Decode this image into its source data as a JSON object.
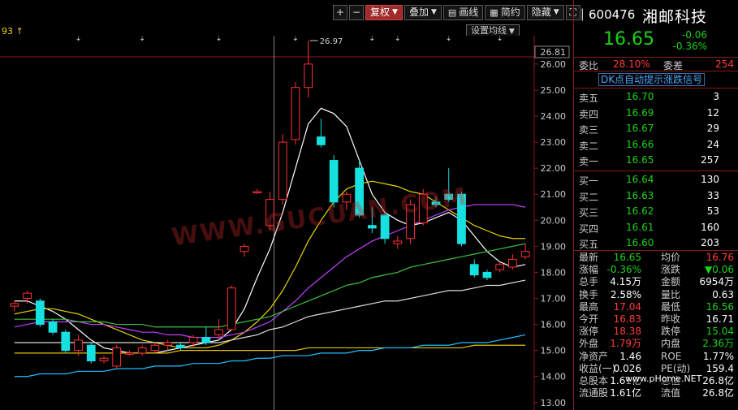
{
  "toolbar": {
    "plus": "+",
    "minus": "−",
    "fuquan": "复权",
    "diejia": "叠加",
    "huaxian": "画线",
    "jianyue": "简约",
    "yincang": "隐藏",
    "fullscreen": "⛶"
  },
  "ma_settings_label": "设置均线",
  "top_left_text": "93 ↑",
  "watermark": "WWW.GUCUAN.COM",
  "watermark2": "www.pHome.NET",
  "quote": {
    "code": "600476",
    "name": "湘邮科技",
    "price": "16.65",
    "change": "-0.06",
    "change_pct": "-0.36%"
  },
  "weibi": {
    "label": "委比",
    "value": "28.10%",
    "label2": "委差",
    "value2": "254"
  },
  "dk_signal": "DK点自动提示涨跌信号",
  "sell": [
    {
      "label": "卖五",
      "price": "16.70",
      "vol": "3"
    },
    {
      "label": "卖四",
      "price": "16.69",
      "vol": "12"
    },
    {
      "label": "卖三",
      "price": "16.67",
      "vol": "29"
    },
    {
      "label": "卖二",
      "price": "16.66",
      "vol": "24"
    },
    {
      "label": "卖一",
      "price": "16.65",
      "vol": "257"
    }
  ],
  "buy": [
    {
      "label": "买一",
      "price": "16.64",
      "vol": "130"
    },
    {
      "label": "买二",
      "price": "16.63",
      "vol": "33"
    },
    {
      "label": "买三",
      "price": "16.62",
      "vol": "53"
    },
    {
      "label": "买四",
      "price": "16.61",
      "vol": "160"
    },
    {
      "label": "买五",
      "price": "16.60",
      "vol": "203"
    }
  ],
  "stats": [
    {
      "l1": "最新",
      "v1": "16.65",
      "c1": "green",
      "l2": "均价",
      "v2": "16.76",
      "c2": "red"
    },
    {
      "l1": "涨幅",
      "v1": "-0.36%",
      "c1": "green",
      "l2": "涨跌",
      "v2": "▼0.06",
      "c2": "green"
    },
    {
      "l1": "总手",
      "v1": "4.15万",
      "c1": "white",
      "l2": "金额",
      "v2": "6954万",
      "c2": "white"
    },
    {
      "l1": "换手",
      "v1": "2.58%",
      "c1": "white",
      "l2": "量比",
      "v2": "0.63",
      "c2": "white"
    },
    {
      "l1": "最高",
      "v1": "17.04",
      "c1": "red",
      "l2": "最低",
      "v2": "16.56",
      "c2": "green"
    },
    {
      "l1": "今开",
      "v1": "16.83",
      "c1": "red",
      "l2": "昨收",
      "v2": "16.71",
      "c2": "white"
    },
    {
      "l1": "涨停",
      "v1": "18.38",
      "c1": "red",
      "l2": "跌停",
      "v2": "15.04",
      "c2": "green"
    },
    {
      "l1": "外盘",
      "v1": "1.79万",
      "c1": "red",
      "l2": "内盘",
      "v2": "2.36万",
      "c2": "green"
    },
    {
      "l1": "净资产",
      "v1": "1.46",
      "c1": "white",
      "l2": "ROE",
      "v2": "1.77%",
      "c2": "white"
    },
    {
      "l1": "收益(一)",
      "v1": "0.026",
      "c1": "white",
      "l2": "PE(动)",
      "v2": "159.4",
      "c2": "white"
    },
    {
      "l1": "总股本",
      "v1": "1.61亿",
      "c1": "white",
      "l2": "总值",
      "v2": "26.8亿",
      "c2": "white"
    },
    {
      "l1": "流通股",
      "v1": "1.61亿",
      "c1": "white",
      "l2": "流值",
      "v2": "26.8亿",
      "c2": "white"
    }
  ],
  "chart_data": {
    "type": "candlestick",
    "ylim": [
      12.9,
      26.9
    ],
    "yticks": [
      "26.00",
      "25.00",
      "24.00",
      "23.00",
      "22.00",
      "21.00",
      "20.00",
      "19.00",
      "18.00",
      "17.00",
      "16.00",
      "15.00",
      "14.00",
      "13.00"
    ],
    "top_price_label": "26.81",
    "high_annotation": "26.97",
    "candles": [
      {
        "o": 16.7,
        "h": 16.9,
        "l": 16.5,
        "c": 16.8
      },
      {
        "o": 17.0,
        "h": 17.3,
        "l": 16.8,
        "c": 17.2
      },
      {
        "o": 16.9,
        "h": 17.0,
        "l": 15.9,
        "c": 16.0
      },
      {
        "o": 16.1,
        "h": 16.2,
        "l": 15.6,
        "c": 15.7
      },
      {
        "o": 15.7,
        "h": 15.8,
        "l": 14.9,
        "c": 15.0
      },
      {
        "o": 15.0,
        "h": 15.6,
        "l": 14.8,
        "c": 15.4
      },
      {
        "o": 15.2,
        "h": 15.3,
        "l": 14.5,
        "c": 14.6
      },
      {
        "o": 14.6,
        "h": 14.8,
        "l": 14.5,
        "c": 14.7
      },
      {
        "o": 14.4,
        "h": 15.2,
        "l": 14.3,
        "c": 15.1
      },
      {
        "o": 14.9,
        "h": 15.0,
        "l": 14.8,
        "c": 14.9
      },
      {
        "o": 14.9,
        "h": 15.2,
        "l": 14.8,
        "c": 15.1
      },
      {
        "o": 15.0,
        "h": 15.3,
        "l": 14.9,
        "c": 15.2
      },
      {
        "o": 15.2,
        "h": 15.4,
        "l": 15.0,
        "c": 15.3
      },
      {
        "o": 15.2,
        "h": 15.3,
        "l": 15.0,
        "c": 15.1
      },
      {
        "o": 15.3,
        "h": 15.6,
        "l": 15.1,
        "c": 15.5
      },
      {
        "o": 15.5,
        "h": 15.9,
        "l": 15.2,
        "c": 15.3
      },
      {
        "o": 15.6,
        "h": 16.2,
        "l": 15.4,
        "c": 15.8
      },
      {
        "o": 15.8,
        "h": 17.5,
        "l": 15.8,
        "c": 17.4
      },
      {
        "o": 18.8,
        "h": 19.1,
        "l": 18.6,
        "c": 19.0
      },
      {
        "o": 21.1,
        "h": 21.2,
        "l": 21.0,
        "c": 21.1
      },
      {
        "o": 19.8,
        "h": 21.1,
        "l": 19.6,
        "c": 20.8
      },
      {
        "o": 20.8,
        "h": 23.3,
        "l": 20.6,
        "c": 23.0
      },
      {
        "o": 23.1,
        "h": 25.3,
        "l": 22.9,
        "c": 25.1
      },
      {
        "o": 25.1,
        "h": 26.9,
        "l": 24.7,
        "c": 26.0
      },
      {
        "o": 23.2,
        "h": 23.9,
        "l": 22.8,
        "c": 22.9
      },
      {
        "o": 22.3,
        "h": 22.5,
        "l": 20.5,
        "c": 20.7
      },
      {
        "o": 20.7,
        "h": 21.1,
        "l": 20.4,
        "c": 21.0
      },
      {
        "o": 22.0,
        "h": 22.3,
        "l": 20.1,
        "c": 20.2
      },
      {
        "o": 19.8,
        "h": 20.5,
        "l": 19.5,
        "c": 19.7
      },
      {
        "o": 20.2,
        "h": 20.3,
        "l": 19.1,
        "c": 19.3
      },
      {
        "o": 19.1,
        "h": 19.4,
        "l": 18.9,
        "c": 19.2
      },
      {
        "o": 19.3,
        "h": 20.8,
        "l": 19.1,
        "c": 20.6
      },
      {
        "o": 19.9,
        "h": 21.2,
        "l": 19.8,
        "c": 21.0
      },
      {
        "o": 20.7,
        "h": 20.9,
        "l": 20.5,
        "c": 20.6
      },
      {
        "o": 21.0,
        "h": 22.0,
        "l": 20.7,
        "c": 20.8
      },
      {
        "o": 21.0,
        "h": 21.1,
        "l": 19.0,
        "c": 19.1
      },
      {
        "o": 18.3,
        "h": 18.5,
        "l": 17.8,
        "c": 17.9
      },
      {
        "o": 18.0,
        "h": 18.1,
        "l": 17.7,
        "c": 17.8
      },
      {
        "o": 18.1,
        "h": 18.4,
        "l": 18.0,
        "c": 18.3
      },
      {
        "o": 18.2,
        "h": 18.7,
        "l": 18.1,
        "c": 18.5
      },
      {
        "o": 18.6,
        "h": 19.1,
        "l": 18.5,
        "c": 18.8
      }
    ],
    "ma": [
      {
        "name": "MA5",
        "color": "#ffffff",
        "values": [
          16.9,
          16.9,
          16.7,
          16.5,
          16.2,
          15.8,
          15.4,
          15.1,
          15.0,
          14.9,
          14.9,
          14.9,
          15.0,
          15.1,
          15.2,
          15.3,
          15.4,
          15.8,
          16.6,
          17.8,
          18.9,
          20.3,
          22.0,
          23.7,
          24.3,
          24.1,
          23.6,
          22.3,
          21.0,
          20.3,
          20.0,
          19.8,
          19.9,
          20.1,
          20.3,
          20.0,
          19.4,
          18.8,
          18.4,
          18.2,
          18.3
        ]
      },
      {
        "name": "MA10",
        "color": "#e6d200",
        "values": [
          16.4,
          16.5,
          16.6,
          16.6,
          16.5,
          16.4,
          16.2,
          16.0,
          15.8,
          15.6,
          15.4,
          15.3,
          15.2,
          15.1,
          15.1,
          15.1,
          15.2,
          15.4,
          15.7,
          16.1,
          16.6,
          17.3,
          18.2,
          19.2,
          20.0,
          20.7,
          21.2,
          21.4,
          21.5,
          21.4,
          21.3,
          21.1,
          21.0,
          20.7,
          20.4,
          20.1,
          19.8,
          19.6,
          19.4,
          19.3,
          19.3
        ]
      },
      {
        "name": "MA20",
        "color": "#c040ff",
        "values": [
          15.9,
          16.0,
          16.1,
          16.1,
          16.1,
          16.1,
          16.0,
          16.0,
          15.9,
          15.8,
          15.7,
          15.7,
          15.6,
          15.6,
          15.5,
          15.5,
          15.5,
          15.6,
          15.7,
          15.9,
          16.1,
          16.5,
          16.9,
          17.4,
          17.8,
          18.2,
          18.6,
          18.9,
          19.2,
          19.4,
          19.6,
          19.8,
          20.0,
          20.2,
          20.4,
          20.5,
          20.6,
          20.6,
          20.6,
          20.6,
          20.5
        ]
      },
      {
        "name": "MA30",
        "color": "#40c040",
        "values": [
          16.2,
          16.2,
          16.2,
          16.2,
          16.2,
          16.1,
          16.1,
          16.1,
          16.0,
          16.0,
          16.0,
          15.9,
          15.9,
          15.9,
          15.9,
          15.9,
          15.9,
          16.0,
          16.1,
          16.2,
          16.3,
          16.5,
          16.7,
          16.9,
          17.1,
          17.3,
          17.5,
          17.6,
          17.8,
          17.9,
          18.0,
          18.2,
          18.3,
          18.4,
          18.5,
          18.6,
          18.7,
          18.8,
          18.9,
          19.0,
          19.1
        ]
      },
      {
        "name": "MA60",
        "color": "#dddddd",
        "values": [
          15.3,
          15.3,
          15.3,
          15.3,
          15.3,
          15.3,
          15.3,
          15.3,
          15.3,
          15.3,
          15.3,
          15.3,
          15.3,
          15.3,
          15.3,
          15.3,
          15.3,
          15.4,
          15.5,
          15.6,
          15.8,
          15.9,
          16.1,
          16.3,
          16.4,
          16.5,
          16.6,
          16.7,
          16.8,
          16.9,
          16.9,
          17.0,
          17.1,
          17.2,
          17.3,
          17.3,
          17.4,
          17.5,
          17.5,
          17.6,
          17.7
        ]
      },
      {
        "name": "MA120",
        "color": "#e6c200",
        "values": [
          14.9,
          14.9,
          14.9,
          14.9,
          14.9,
          14.9,
          14.9,
          14.9,
          14.9,
          14.9,
          14.9,
          14.9,
          14.9,
          15.0,
          15.0,
          15.0,
          15.0,
          15.0,
          15.0,
          15.0,
          15.0,
          15.0,
          15.0,
          15.1,
          15.1,
          15.1,
          15.1,
          15.1,
          15.1,
          15.1,
          15.1,
          15.1,
          15.1,
          15.1,
          15.1,
          15.1,
          15.2,
          15.2,
          15.2,
          15.2,
          15.2
        ]
      },
      {
        "name": "MA250",
        "color": "#20c0ff",
        "values": [
          14.0,
          14.0,
          14.1,
          14.1,
          14.1,
          14.2,
          14.2,
          14.2,
          14.3,
          14.3,
          14.3,
          14.4,
          14.4,
          14.4,
          14.5,
          14.5,
          14.5,
          14.6,
          14.6,
          14.7,
          14.7,
          14.8,
          14.8,
          14.8,
          14.9,
          14.9,
          14.9,
          15.0,
          15.0,
          15.1,
          15.1,
          15.1,
          15.2,
          15.2,
          15.2,
          15.3,
          15.3,
          15.3,
          15.4,
          15.5,
          15.6
        ]
      }
    ]
  }
}
